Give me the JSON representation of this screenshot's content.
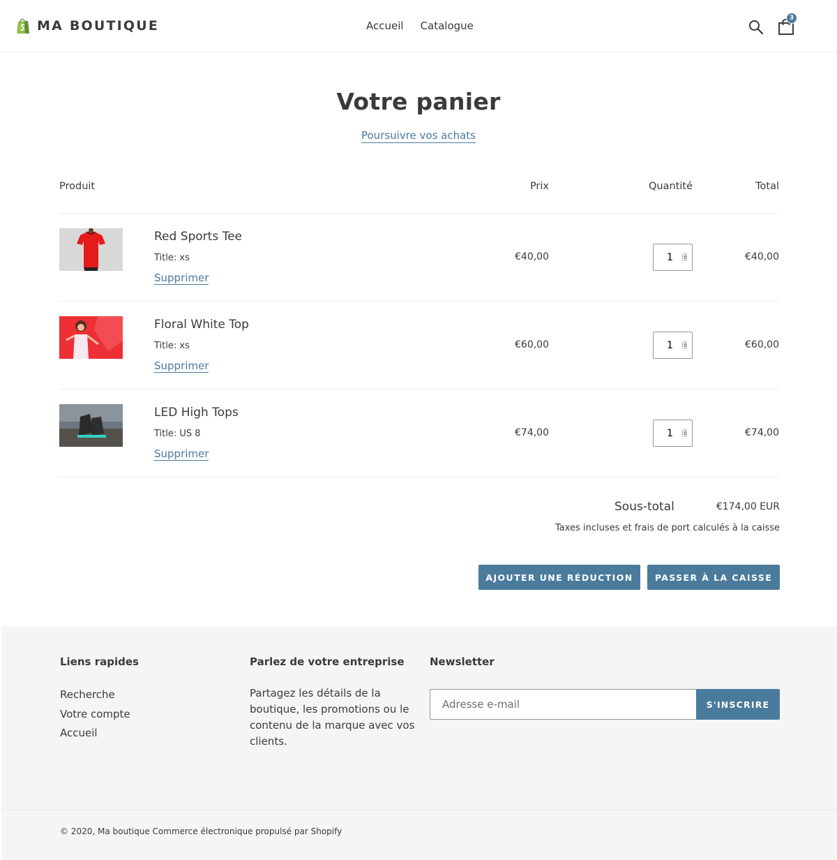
{
  "header": {
    "brand": "MA BOUTIQUE",
    "nav": [
      "Accueil",
      "Catalogue"
    ],
    "cart_count": "3",
    "accent_color": "#4a7b9d",
    "logo_icon": "shopify-bag-icon"
  },
  "main": {
    "title": "Votre panier",
    "continue_link": "Poursuivre vos achats",
    "columns": {
      "product": "Produit",
      "price": "Prix",
      "quantity": "Quantité",
      "total": "Total"
    },
    "items": [
      {
        "name": "Red Sports Tee",
        "variant": "Title: xs",
        "remove": "Supprimer",
        "price": "€40,00",
        "quantity": "1",
        "total": "€40,00"
      },
      {
        "name": "Floral White Top",
        "variant": "Title: xs",
        "remove": "Supprimer",
        "price": "€60,00",
        "quantity": "1",
        "total": "€60,00"
      },
      {
        "name": "LED High Tops",
        "variant": "Title: US 8",
        "remove": "Supprimer",
        "price": "€74,00",
        "quantity": "1",
        "total": "€74,00"
      }
    ],
    "subtotal_label": "Sous-total",
    "subtotal_value": "€174,00 EUR",
    "tax_note": "Taxes incluses et frais de port calculés à la caisse",
    "discount_button": "AJOUTER UNE RÉDUCTION",
    "checkout_button": "PASSER À LA CAISSE"
  },
  "footer": {
    "quick_links_title": "Liens rapides",
    "quick_links": [
      "Recherche",
      "Votre compte",
      "Accueil"
    ],
    "about_title": "Parlez de votre entreprise",
    "about_text": "Partagez les détails de la boutique, les promotions ou le contenu de la marque avec vos clients.",
    "newsletter_title": "Newsletter",
    "email_placeholder": "Adresse e-mail",
    "subscribe_button": "S'INSCRIRE",
    "copyright": "© 2020, Ma boutique Commerce électronique propulsé par Shopify"
  }
}
